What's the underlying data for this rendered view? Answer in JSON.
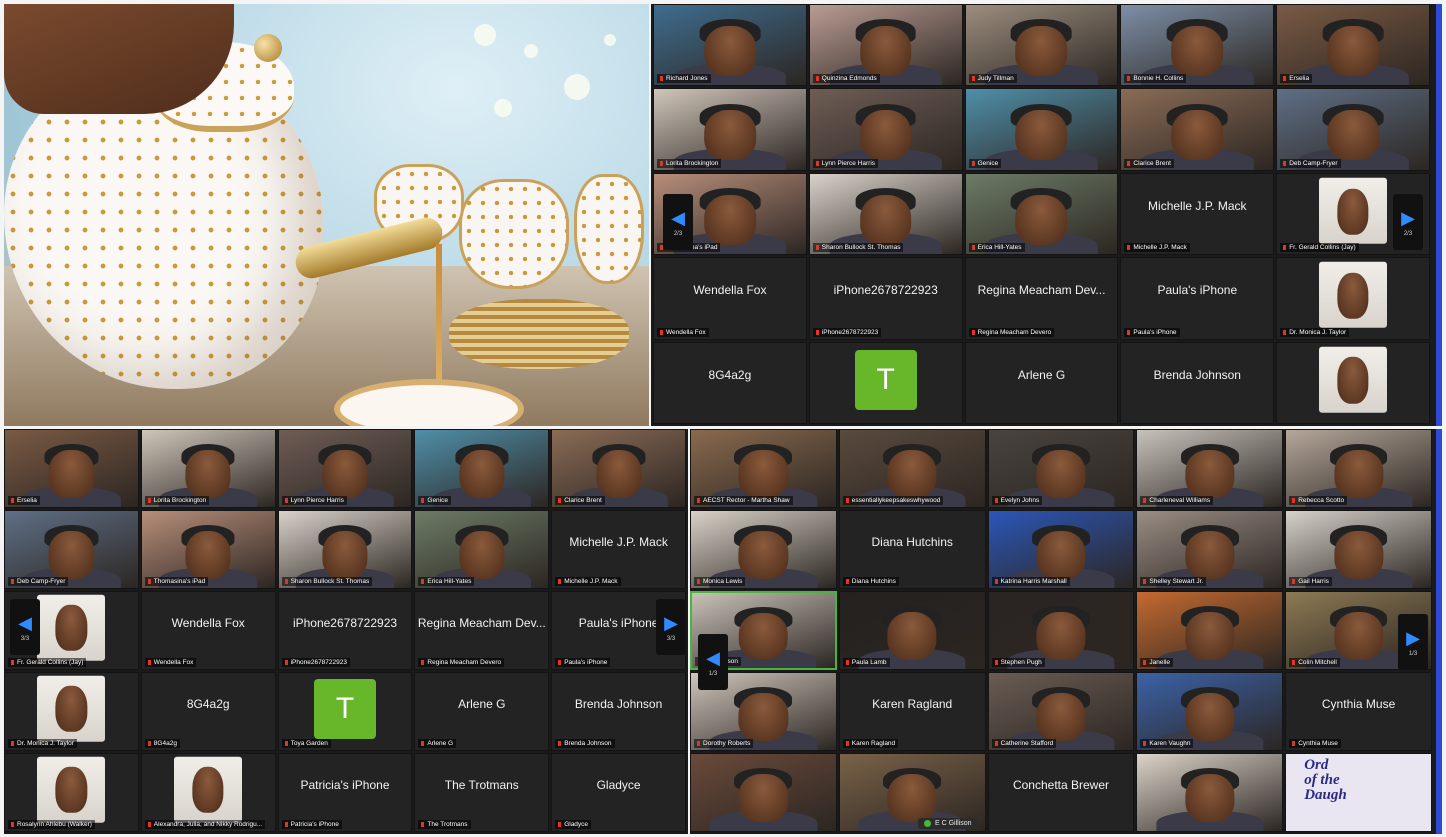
{
  "panel_top_right": {
    "nav_left": {
      "glyph": "◀",
      "page": "2/3"
    },
    "nav_right": {
      "glyph": "▶",
      "page": "2/3"
    },
    "tiles": [
      {
        "label": "Richard Jones",
        "name": "",
        "kind": "video",
        "bg": "#3f6d8f"
      },
      {
        "label": "Quinzina Edmonds",
        "name": "",
        "kind": "video",
        "bg": "#b99c93"
      },
      {
        "label": "Judy Tillman",
        "name": "",
        "kind": "video",
        "bg": "#9c8e7e"
      },
      {
        "label": "Bonnie H. Collins",
        "name": "",
        "kind": "video",
        "bg": "#7d8fa7"
      },
      {
        "label": "Erselia",
        "name": "",
        "kind": "video",
        "bg": "#7a5a44"
      },
      {
        "label": "Lorita Brockington",
        "name": "",
        "kind": "video",
        "bg": "#cfc6ba"
      },
      {
        "label": "Lynn Pierce Harris",
        "name": "",
        "kind": "video",
        "bg": "#6e5d55"
      },
      {
        "label": "Genice",
        "name": "",
        "kind": "video",
        "bg": "#4f8fa9"
      },
      {
        "label": "Clarice Brent",
        "name": "",
        "kind": "video",
        "bg": "#8a6c56"
      },
      {
        "label": "Deb Camp-Fryer",
        "name": "",
        "kind": "video",
        "bg": "#5f6f86"
      },
      {
        "label": "Thomasina's iPad",
        "name": "",
        "kind": "video",
        "bg": "#b88e7a"
      },
      {
        "label": "Sharon Bullock St. Thomas",
        "name": "",
        "kind": "video",
        "bg": "#d8d2c9"
      },
      {
        "label": "Erica Hill-Yates",
        "name": "",
        "kind": "video",
        "bg": "#6c7c66"
      },
      {
        "label": "Michelle J.P. Mack",
        "name": "Michelle J.P. Mack",
        "kind": "name"
      },
      {
        "label": "Fr. Gerald Collins (Jay)",
        "name": "",
        "kind": "photo"
      },
      {
        "label": "Wendella Fox",
        "name": "Wendella Fox",
        "kind": "name"
      },
      {
        "label": "iPhone2678722923",
        "name": "iPhone2678722923",
        "kind": "name"
      },
      {
        "label": "Regina Meacham Devero",
        "name": "Regina Meacham Dev...",
        "kind": "name"
      },
      {
        "label": "Paula's iPhone",
        "name": "Paula's iPhone",
        "kind": "name"
      },
      {
        "label": "Dr. Monica J. Taylor",
        "name": "",
        "kind": "photo"
      },
      {
        "label": "",
        "name": "8G4a2g",
        "kind": "name"
      },
      {
        "label": "",
        "name": "",
        "kind": "avatar",
        "letter": "T"
      },
      {
        "label": "",
        "name": "Arlene G",
        "kind": "name"
      },
      {
        "label": "",
        "name": "Brenda Johnson",
        "kind": "name"
      },
      {
        "label": "",
        "name": "",
        "kind": "photo"
      }
    ]
  },
  "panel_bottom_left": {
    "nav_left": {
      "glyph": "◀",
      "page": "3/3"
    },
    "nav_right": {
      "glyph": "▶",
      "page": "3/3"
    },
    "tiles": [
      {
        "label": "Erselia",
        "name": "",
        "kind": "video",
        "bg": "#7a5a44"
      },
      {
        "label": "Lorita Brockington",
        "name": "",
        "kind": "video",
        "bg": "#cfc6ba"
      },
      {
        "label": "Lynn Pierce Harris",
        "name": "",
        "kind": "video",
        "bg": "#6e5d55"
      },
      {
        "label": "Genice",
        "name": "",
        "kind": "video",
        "bg": "#4f8fa9"
      },
      {
        "label": "Clarice Brent",
        "name": "",
        "kind": "video",
        "bg": "#8a6c56"
      },
      {
        "label": "Deb Camp-Fryer",
        "name": "",
        "kind": "video",
        "bg": "#5f6f86"
      },
      {
        "label": "Thomasina's iPad",
        "name": "",
        "kind": "video",
        "bg": "#b88e7a"
      },
      {
        "label": "Sharon Bullock St. Thomas",
        "name": "",
        "kind": "video",
        "bg": "#d8d2c9"
      },
      {
        "label": "Erica Hill-Yates",
        "name": "",
        "kind": "video",
        "bg": "#6c7c66"
      },
      {
        "label": "Michelle J.P. Mack",
        "name": "Michelle J.P. Mack",
        "kind": "name"
      },
      {
        "label": "Fr. Gerald Collins (Jay)",
        "name": "",
        "kind": "photo"
      },
      {
        "label": "Wendella Fox",
        "name": "Wendella Fox",
        "kind": "name"
      },
      {
        "label": "iPhone2678722923",
        "name": "iPhone2678722923",
        "kind": "name"
      },
      {
        "label": "Regina Meacham Devero",
        "name": "Regina Meacham Dev...",
        "kind": "name"
      },
      {
        "label": "Paula's iPhone",
        "name": "Paula's iPhone",
        "kind": "name"
      },
      {
        "label": "Dr. Monica J. Taylor",
        "name": "",
        "kind": "photo"
      },
      {
        "label": "8G4a2g",
        "name": "8G4a2g",
        "kind": "name"
      },
      {
        "label": "Toya Garden",
        "name": "",
        "kind": "avatar",
        "letter": "T"
      },
      {
        "label": "Arlene G",
        "name": "Arlene G",
        "kind": "name"
      },
      {
        "label": "Brenda Johnson",
        "name": "Brenda Johnson",
        "kind": "name"
      },
      {
        "label": "Rosalynn Ahlebu (Walker)",
        "name": "",
        "kind": "photo"
      },
      {
        "label": "Alexandra, Julia, and Nikky Rodrigu...",
        "name": "",
        "kind": "photo"
      },
      {
        "label": "Patricia's iPhone",
        "name": "Patricia's iPhone",
        "kind": "name"
      },
      {
        "label": "The Trotmans",
        "name": "The Trotmans",
        "kind": "name"
      },
      {
        "label": "Gladyce",
        "name": "Gladyce",
        "kind": "name"
      }
    ]
  },
  "panel_bottom_right": {
    "nav_right": {
      "glyph": "▶",
      "page": "1/3"
    },
    "nav_mid": {
      "glyph": "◀",
      "page": "1/3"
    },
    "toolbar_label": "E C Gillison",
    "tiles": [
      {
        "label": "AECST Rector - Martha Shaw",
        "name": "",
        "kind": "video",
        "bg": "#8a6a4e"
      },
      {
        "label": "essentiallykeepsakeswhywood",
        "name": "",
        "kind": "video",
        "bg": "#5a4a3d"
      },
      {
        "label": "Evelyn Johns",
        "name": "",
        "kind": "video",
        "bg": "#4a4440"
      },
      {
        "label": "Charleneval Williams",
        "name": "",
        "kind": "video",
        "bg": "#c7c2bc"
      },
      {
        "label": "Rebecca Scotto",
        "name": "",
        "kind": "video",
        "bg": "#b5a79a"
      },
      {
        "label": "Monica Lewis",
        "name": "",
        "kind": "video",
        "bg": "#d8d2c8"
      },
      {
        "label": "Diana Hutchins",
        "name": "Diana Hutchins",
        "kind": "name"
      },
      {
        "label": "Katrina Harris Marshall",
        "name": "",
        "kind": "video",
        "bg": "#2b56b8"
      },
      {
        "label": "Shelley Stewart Jr.",
        "name": "",
        "kind": "video",
        "bg": "#9a8d84"
      },
      {
        "label": "Gail Harris",
        "name": "",
        "kind": "video",
        "bg": "#d6d1ca"
      },
      {
        "label": "E C Gillison",
        "name": "",
        "kind": "video",
        "bg": "#c9c2b8"
      },
      {
        "label": "Paula Lamb",
        "name": "",
        "kind": "video",
        "bg": "#24211f"
      },
      {
        "label": "Stephen Pugh",
        "name": "",
        "kind": "video",
        "bg": "#2a2523"
      },
      {
        "label": "Janelle",
        "name": "",
        "kind": "video",
        "bg": "#c46a30"
      },
      {
        "label": "Colin Mitchell",
        "name": "",
        "kind": "video",
        "bg": "#8d7a54"
      },
      {
        "label": "Dorothy Roberts",
        "name": "",
        "kind": "video",
        "bg": "#cfc6bc"
      },
      {
        "label": "Karen Ragland",
        "name": "Karen Ragland",
        "kind": "name"
      },
      {
        "label": "Catherine Stafford",
        "name": "",
        "kind": "video",
        "bg": "#6a5c54"
      },
      {
        "label": "Karen Vaughn",
        "name": "",
        "kind": "video",
        "bg": "#3b62a8"
      },
      {
        "label": "Cynthia Muse",
        "name": "Cynthia Muse",
        "kind": "name"
      },
      {
        "label": "",
        "name": "",
        "kind": "video",
        "bg": "#6a4a3a"
      },
      {
        "label": "",
        "name": "",
        "kind": "video",
        "bg": "#7a6248"
      },
      {
        "label": "",
        "name": "Conchetta Brewer",
        "kind": "name"
      },
      {
        "label": "",
        "name": "",
        "kind": "video",
        "bg": "#dcd4ca"
      },
      {
        "label": "",
        "name": "Order of the Daughters",
        "kind": "banner"
      }
    ]
  },
  "banner_text": [
    "Ord",
    "of the",
    "Daugh"
  ]
}
